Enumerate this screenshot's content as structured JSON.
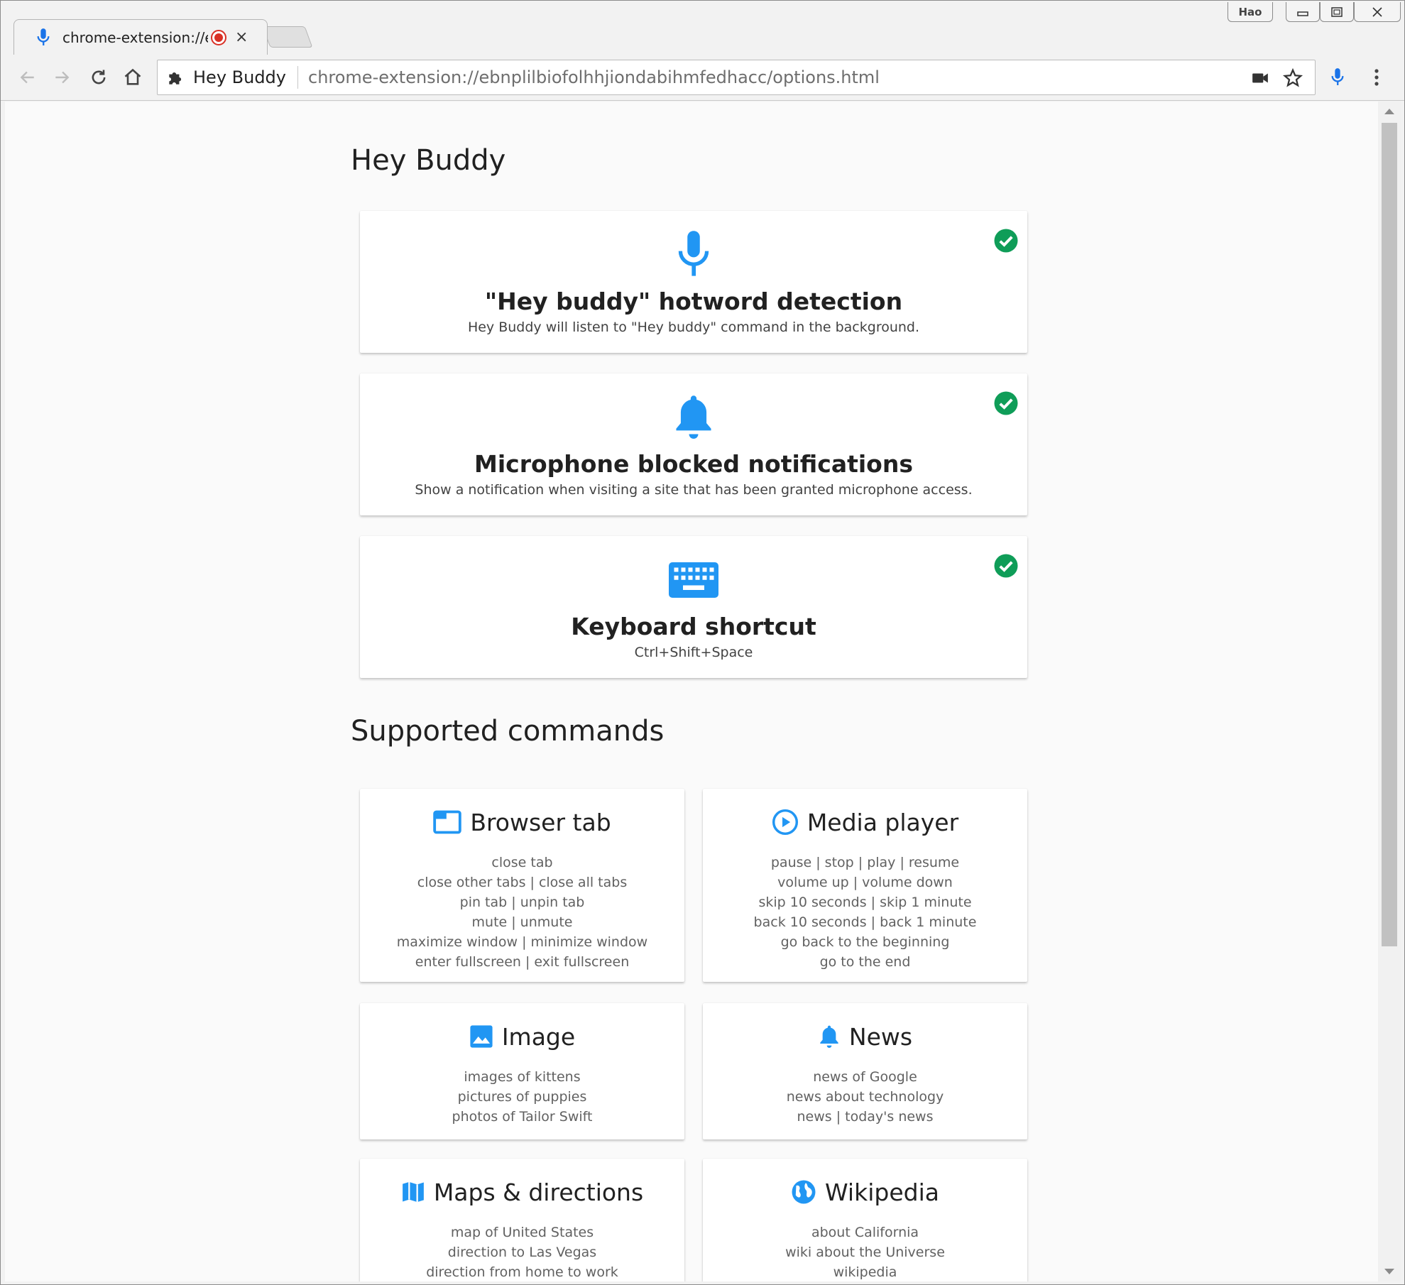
{
  "browser": {
    "tab": {
      "title": "chrome-extension://ebnplilbiofolhhjiondabihmfedhacc/options.html",
      "close": "×"
    },
    "profile": "Hao",
    "window_controls": {
      "minimize": "▭",
      "maximize": "⧉",
      "close": "✕"
    },
    "omnibox": {
      "site_name": "Hey Buddy",
      "url": "chrome-extension://ebnplilbiofolhhjiondabihmfedhacc/options.html"
    },
    "accent": "#1a73e8"
  },
  "page": {
    "title": "Hey Buddy",
    "features": [
      {
        "title": "\"Hey buddy\" hotword detection",
        "desc": "Hey Buddy will listen to \"Hey buddy\" command in the background.",
        "icon": "microphone-icon",
        "enabled": true
      },
      {
        "title": "Microphone blocked notifications",
        "desc": "Show a notification when visiting a site that has been granted microphone access.",
        "icon": "bell-icon",
        "enabled": true
      },
      {
        "title": "Keyboard shortcut",
        "desc": "Ctrl+Shift+Space",
        "icon": "keyboard-icon",
        "enabled": true
      }
    ],
    "commands_title": "Supported commands",
    "commands": [
      {
        "title": "Browser tab",
        "icon": "browser-tab-icon",
        "lines": [
          "close tab",
          "close other tabs | close all tabs",
          "pin tab | unpin tab",
          "mute | unmute",
          "maximize window | minimize window",
          "enter fullscreen | exit fullscreen"
        ]
      },
      {
        "title": "Media player",
        "icon": "play-circle-icon",
        "lines": [
          "pause | stop | play | resume",
          "volume up | volume down",
          "skip 10 seconds | skip 1 minute",
          "back 10 seconds | back 1 minute",
          "go back to the beginning",
          "go to the end"
        ]
      },
      {
        "title": "Image",
        "icon": "image-icon",
        "lines": [
          "images of kittens",
          "pictures of puppies",
          "photos of Tailor Swift"
        ]
      },
      {
        "title": "News",
        "icon": "bell-icon",
        "lines": [
          "news of Google",
          "news about technology",
          "news | today's news"
        ]
      },
      {
        "title": "Maps & directions",
        "icon": "map-icon",
        "lines": [
          "map of United States",
          "direction to Las Vegas",
          "direction from home to work"
        ]
      },
      {
        "title": "Wikipedia",
        "icon": "globe-icon",
        "lines": [
          "about California",
          "wiki about the Universe",
          "wikipedia"
        ]
      }
    ],
    "colors": {
      "icon_blue": "#2196f3",
      "check_green": "#0f9d58"
    }
  }
}
